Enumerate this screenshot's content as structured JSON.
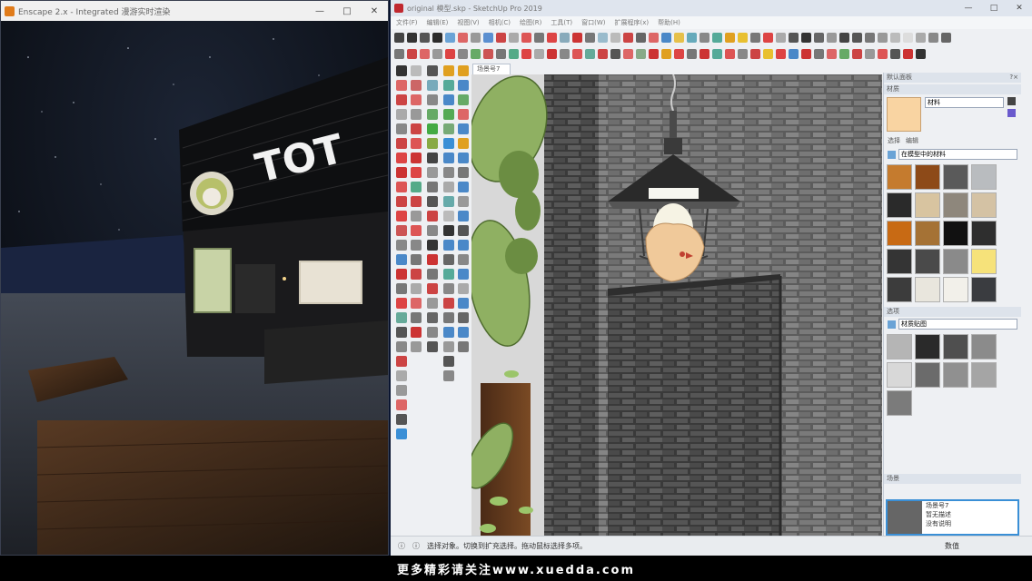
{
  "enscape_window": {
    "title": "Enscape 2.x - Integrated 漫游实时渲染",
    "brand_color": "#e07b1a",
    "buttons": {
      "minimize": "—",
      "maximize": "□",
      "close": "✕"
    },
    "signage_text": "TOT"
  },
  "sketchup_window": {
    "title": "original 模型.skp - SketchUp Pro 2019",
    "brand_color": "#c0282f",
    "buttons": {
      "minimize": "—",
      "maximize": "□",
      "close": "✕"
    },
    "menu": [
      "文件(F)",
      "编辑(E)",
      "视图(V)",
      "相机(C)",
      "绘图(R)",
      "工具(T)",
      "窗口(W)",
      "扩展程序(x)",
      "帮助(H)"
    ],
    "scene_tab": "场景号7",
    "status_text": "选择对象。切换到扩充选择。拖动鼠标选择多项。",
    "status_field_label": "数值"
  },
  "tray": {
    "title": "默认面板",
    "materials_header": "材质",
    "material_name": "材料",
    "material_color": "#f9d4a2",
    "select_tab": "选择",
    "edit_tab": "编辑",
    "collection": "在模型中的材料",
    "styles_header": "选项",
    "styles_collection": "材质贴图",
    "scenes_header": "场景",
    "scene_name": "场景号7",
    "scene_desc_1": "暂无描述",
    "scene_desc_2": "没有说明",
    "material_swatches": [
      "#c57b2e",
      "#8d4a18",
      "#5a5a5a",
      "#b9bcbf",
      "#2a2a2a",
      "#d8c4a0",
      "#8e877c",
      "#d4c2a4",
      "#c86a14",
      "#a57235",
      "#111111",
      "#2e2e2e",
      "#343434",
      "#4a4a4a",
      "#8a8a8a",
      "#f6e27a",
      "#3c3c3c",
      "#e9e6dd",
      "#f2f0ea",
      "#3a3c40"
    ],
    "style_swatches": [
      "#b5b5b5",
      "#2a2a2a",
      "#4f4f4f",
      "#8b8b8b",
      "#d8d8d8",
      "#6b6b6b",
      "#909090",
      "#a5a5a5",
      "#7b7b7b"
    ]
  },
  "watermark": "更多精彩请关注www.xuedda.com"
}
